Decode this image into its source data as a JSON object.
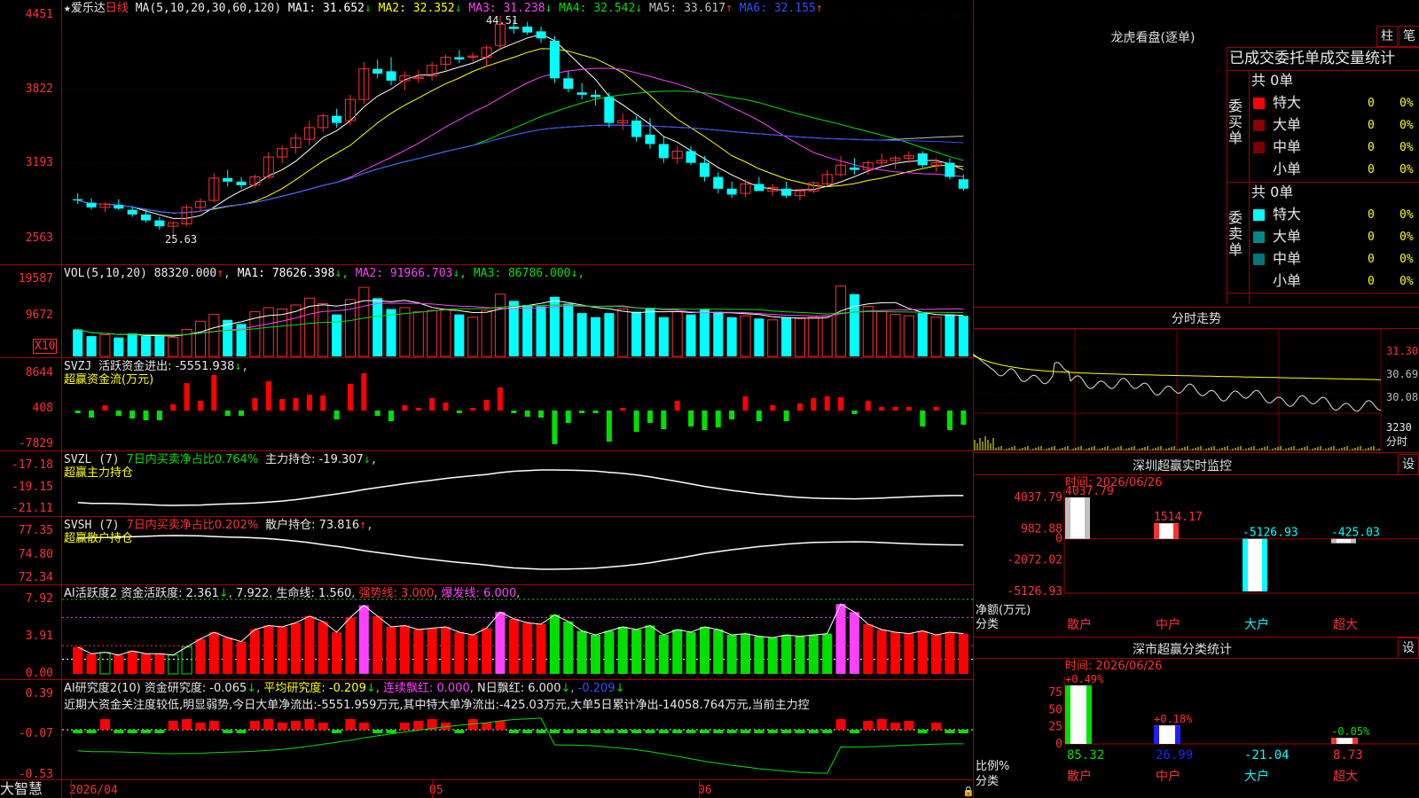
{
  "app": {
    "brand": "大智慧"
  },
  "main": {
    "star": "★",
    "stock_name": "爱乐达",
    "period": "日线",
    "ma_label": "MA(5,10,20,30,60,120)",
    "ma_values": [
      {
        "label": "MA1:",
        "value": "31.652",
        "arrow": "↓",
        "color": "#ffffff"
      },
      {
        "label": "MA2:",
        "value": "32.352",
        "arrow": "↓",
        "color": "#ffff00"
      },
      {
        "label": "MA3:",
        "value": "31.238",
        "arrow": "↓",
        "color": "#ff40ff"
      },
      {
        "label": "MA4:",
        "value": "32.542",
        "arrow": "↓",
        "color": "#00e000"
      },
      {
        "label": "MA5:",
        "value": "33.617",
        "arrow": "↑",
        "color": "#c0c0c0"
      },
      {
        "label": "MA6:",
        "value": "32.155",
        "arrow": "↑",
        "color": "#3050ff"
      }
    ],
    "y_ticks": [
      "4451",
      "3822",
      "3193",
      "2563"
    ],
    "high_label": "44.51",
    "low_label": "25.63"
  },
  "vol": {
    "label": "VOL(5,10,20)",
    "value": "88320.000",
    "value_arrow": "↑",
    "ma": [
      {
        "label": "MA1:",
        "value": "78626.398",
        "arrow": "↓",
        "color": "#ffffff"
      },
      {
        "label": "MA2:",
        "value": "91966.703",
        "arrow": "↓",
        "color": "#ff40ff"
      },
      {
        "label": "MA3:",
        "value": "86786.000",
        "arrow": "↓",
        "color": "#00e000"
      }
    ],
    "y_ticks": [
      "19587",
      "9672"
    ],
    "unit": "X10"
  },
  "svzj": {
    "label": "SVZJ",
    "text": "活跃资金进出: -5551.938",
    "arrow": "↓",
    "sub": "超赢资金流(万元)",
    "y_ticks": [
      "8644",
      "408",
      "-7829"
    ]
  },
  "svzl": {
    "label": "SVZL (7)",
    "ratio": "7日内买卖净占比0.764%",
    "hold": "主力持仓: -19.307",
    "arrow": "↓",
    "sub": "超赢主力持仓",
    "y_ticks": [
      "-17.18",
      "-19.15",
      "-21.11"
    ]
  },
  "svsh": {
    "label": "SVSH (7)",
    "ratio": "7日内买卖净占比0.202%",
    "hold": "散户持仓: 73.816",
    "arrow": "↑",
    "sub": "超赢散户持仓",
    "y_ticks": [
      "77.35",
      "74.80",
      "72.34"
    ]
  },
  "ai_act": {
    "label": "AI活跃度2",
    "t1": "资金活跃度: 2.361",
    "a1": "↓",
    "t2": "7.922",
    "t3": "生命线: 1.560",
    "t4": "强势线: 3.000",
    "t5": "爆发线: 6.000",
    "y_ticks": [
      "7.92",
      "3.91",
      "0.00"
    ]
  },
  "ai_res": {
    "label": "AI研究度2(10)",
    "t1": "资金研究度: -0.065",
    "a1": "↓",
    "t2": "平均研究度: -0.209",
    "a2": "↓",
    "t3": "连续飘红: 0.000",
    "t4": "N日飘红: 6.000",
    "a4": "↓",
    "t5": "-0.209",
    "a5": "↓",
    "comment": "近期大资金关注度较低,明显弱势,今日大单净流出:-5551.959万元,其中特大单净流出:-425.03万元,大单5日累计净出-14058.764万元,当前主力控",
    "y_ticks": [
      "0.39",
      "-0.07",
      "-0.53"
    ]
  },
  "date_axis": [
    "2026/04",
    "05",
    "06"
  ],
  "longhu": {
    "title": "龙虎看盘(逐单)",
    "btn1": "柱",
    "btn2": "笔",
    "header": "已成交委托单成交量统计",
    "buy_group": "委买单",
    "sell_group": "委卖单",
    "buy_total": "共 0单",
    "sell_total": "共 0单",
    "rows": [
      {
        "label": "特大",
        "count": "0",
        "pct": "0%"
      },
      {
        "label": "大单",
        "count": "0",
        "pct": "0%"
      },
      {
        "label": "中单",
        "count": "0",
        "pct": "0%"
      },
      {
        "label": "小单",
        "count": "0",
        "pct": "0%"
      }
    ],
    "buy_colors": [
      "#ff0000",
      "#8b0000",
      "#7a0000",
      ""
    ],
    "sell_colors": [
      "#00ffff",
      "#008888",
      "#007777",
      ""
    ]
  },
  "intraday": {
    "title": "分时走势",
    "y_ticks": [
      "31.30",
      "30.69",
      "30.08"
    ],
    "vol_label": "3230",
    "vol_unit": "分时"
  },
  "monitor": {
    "title": "深圳超赢实时监控",
    "set_btn": "设",
    "time": "时间: 2026/06/26",
    "y_ticks": [
      "4037.79",
      "982.88",
      "0",
      "-2072.02",
      "-5126.93"
    ],
    "y_unit": "净额(万元)",
    "x_unit": "分类",
    "categories": [
      "散户",
      "中户",
      "大户",
      "超大"
    ],
    "values": [
      4037.79,
      1514.17,
      -5126.93,
      -425.03
    ],
    "value_labels": [
      "4037.79",
      "1514.17",
      "-5126.93",
      "-425.03"
    ]
  },
  "classify": {
    "title": "深市超赢分类统计",
    "set_btn": "设",
    "time": "时间: 2026/06/26",
    "y_ticks": [
      "75",
      "50",
      "25",
      "0"
    ],
    "y_unit": "比例%",
    "x_unit": "分类",
    "categories": [
      "散户",
      "中户",
      "大户",
      "超大"
    ],
    "values": [
      85.32,
      26.99,
      -21.04,
      8.73
    ],
    "value_labels": [
      "85.32",
      "26.99",
      "-21.04",
      "8.73"
    ],
    "pct_labels": [
      "+0.49%",
      "+0.18%",
      "",
      "-0.05%"
    ]
  },
  "chart_data": {
    "type": "candlestick",
    "title": "爱乐达 日线",
    "x": [
      "2026/04",
      "05",
      "06"
    ],
    "ylim": [
      25.63,
      44.51
    ],
    "candles": [
      [
        28.9,
        29.4,
        28.5,
        28.8
      ],
      [
        28.6,
        29.0,
        28.0,
        28.2
      ],
      [
        28.2,
        28.6,
        27.8,
        28.5
      ],
      [
        28.4,
        28.9,
        28.0,
        28.1
      ],
      [
        28.0,
        28.3,
        27.4,
        27.6
      ],
      [
        27.6,
        28.0,
        26.9,
        27.1
      ],
      [
        27.1,
        27.4,
        26.3,
        26.6
      ],
      [
        26.6,
        27.0,
        25.63,
        26.9
      ],
      [
        26.8,
        28.4,
        26.6,
        28.2
      ],
      [
        28.2,
        29.0,
        27.9,
        28.7
      ],
      [
        28.8,
        31.1,
        28.6,
        30.7
      ],
      [
        30.7,
        31.4,
        30.0,
        30.4
      ],
      [
        30.4,
        30.8,
        29.8,
        30.1
      ],
      [
        30.1,
        31.0,
        29.9,
        30.8
      ],
      [
        30.8,
        32.9,
        30.6,
        32.5
      ],
      [
        32.5,
        33.5,
        32.0,
        33.2
      ],
      [
        33.3,
        34.5,
        32.8,
        34.1
      ],
      [
        34.0,
        35.6,
        33.5,
        35.0
      ],
      [
        35.0,
        36.2,
        34.6,
        36.0
      ],
      [
        36.0,
        36.6,
        35.0,
        35.4
      ],
      [
        35.6,
        37.8,
        35.2,
        37.4
      ],
      [
        37.4,
        40.6,
        37.0,
        40.0
      ],
      [
        40.0,
        40.8,
        39.2,
        39.6
      ],
      [
        39.8,
        41.0,
        38.6,
        39.0
      ],
      [
        39.0,
        39.8,
        38.2,
        39.4
      ],
      [
        39.2,
        39.9,
        38.8,
        39.3
      ],
      [
        39.4,
        40.6,
        39.0,
        40.3
      ],
      [
        40.4,
        41.2,
        39.9,
        41.0
      ],
      [
        41.0,
        41.6,
        40.5,
        40.8
      ],
      [
        41.0,
        41.4,
        40.6,
        41.1
      ],
      [
        41.0,
        42.0,
        40.2,
        41.8
      ],
      [
        42.0,
        44.51,
        41.6,
        43.8
      ],
      [
        43.6,
        44.2,
        43.0,
        43.4
      ],
      [
        43.6,
        44.0,
        42.9,
        43.1
      ],
      [
        43.2,
        43.6,
        42.2,
        42.6
      ],
      [
        42.4,
        42.8,
        38.8,
        39.2
      ],
      [
        39.2,
        39.8,
        38.0,
        38.3
      ],
      [
        38.0,
        38.8,
        37.4,
        37.8
      ],
      [
        37.8,
        38.2,
        36.9,
        37.6
      ],
      [
        37.6,
        38.0,
        35.0,
        35.4
      ],
      [
        35.4,
        36.2,
        34.8,
        35.6
      ],
      [
        35.6,
        36.0,
        33.8,
        34.2
      ],
      [
        34.4,
        35.8,
        33.2,
        33.6
      ],
      [
        33.6,
        34.2,
        32.0,
        32.4
      ],
      [
        32.4,
        33.4,
        31.9,
        33.0
      ],
      [
        33.0,
        33.4,
        31.8,
        32.0
      ],
      [
        32.0,
        32.6,
        30.4,
        30.8
      ],
      [
        30.8,
        31.2,
        29.4,
        29.8
      ],
      [
        29.8,
        30.4,
        29.0,
        29.3
      ],
      [
        29.4,
        30.6,
        29.1,
        30.2
      ],
      [
        30.2,
        30.8,
        29.6,
        29.6
      ],
      [
        29.6,
        30.2,
        29.2,
        29.9
      ],
      [
        29.8,
        30.4,
        29.0,
        29.2
      ],
      [
        29.2,
        29.8,
        28.8,
        29.6
      ],
      [
        29.6,
        30.4,
        29.4,
        30.3
      ],
      [
        30.2,
        31.4,
        30.0,
        31.0
      ],
      [
        31.0,
        32.6,
        30.8,
        31.8
      ],
      [
        31.6,
        32.4,
        31.0,
        31.4
      ],
      [
        31.4,
        32.2,
        31.0,
        32.0
      ],
      [
        32.0,
        32.8,
        31.6,
        32.2
      ],
      [
        32.2,
        32.6,
        31.5,
        32.4
      ],
      [
        32.4,
        33.0,
        32.0,
        32.6
      ],
      [
        32.8,
        33.0,
        31.6,
        31.8
      ],
      [
        31.8,
        32.4,
        31.2,
        32.0
      ],
      [
        32.0,
        32.4,
        30.6,
        30.8
      ],
      [
        30.6,
        31.0,
        29.6,
        29.8
      ]
    ],
    "volume": [
      40,
      30,
      32,
      28,
      34,
      30,
      30,
      28,
      40,
      52,
      62,
      54,
      48,
      66,
      72,
      70,
      76,
      86,
      78,
      62,
      84,
      102,
      86,
      70,
      72,
      66,
      68,
      70,
      62,
      58,
      68,
      92,
      82,
      76,
      74,
      88,
      78,
      64,
      58,
      64,
      70,
      66,
      72,
      58,
      66,
      62,
      70,
      66,
      58,
      60,
      56,
      54,
      58,
      56,
      58,
      60,
      104,
      92,
      74,
      66,
      62,
      60,
      64,
      58,
      62,
      60
    ],
    "series": [
      {
        "name": "MA1",
        "color": "#ffffff"
      },
      {
        "name": "MA2",
        "color": "#ffff00"
      },
      {
        "name": "MA3",
        "color": "#ff40ff"
      },
      {
        "name": "MA4",
        "color": "#00e000"
      },
      {
        "name": "MA5",
        "color": "#c0c0c0"
      },
      {
        "name": "MA6",
        "color": "#3050ff"
      }
    ]
  }
}
